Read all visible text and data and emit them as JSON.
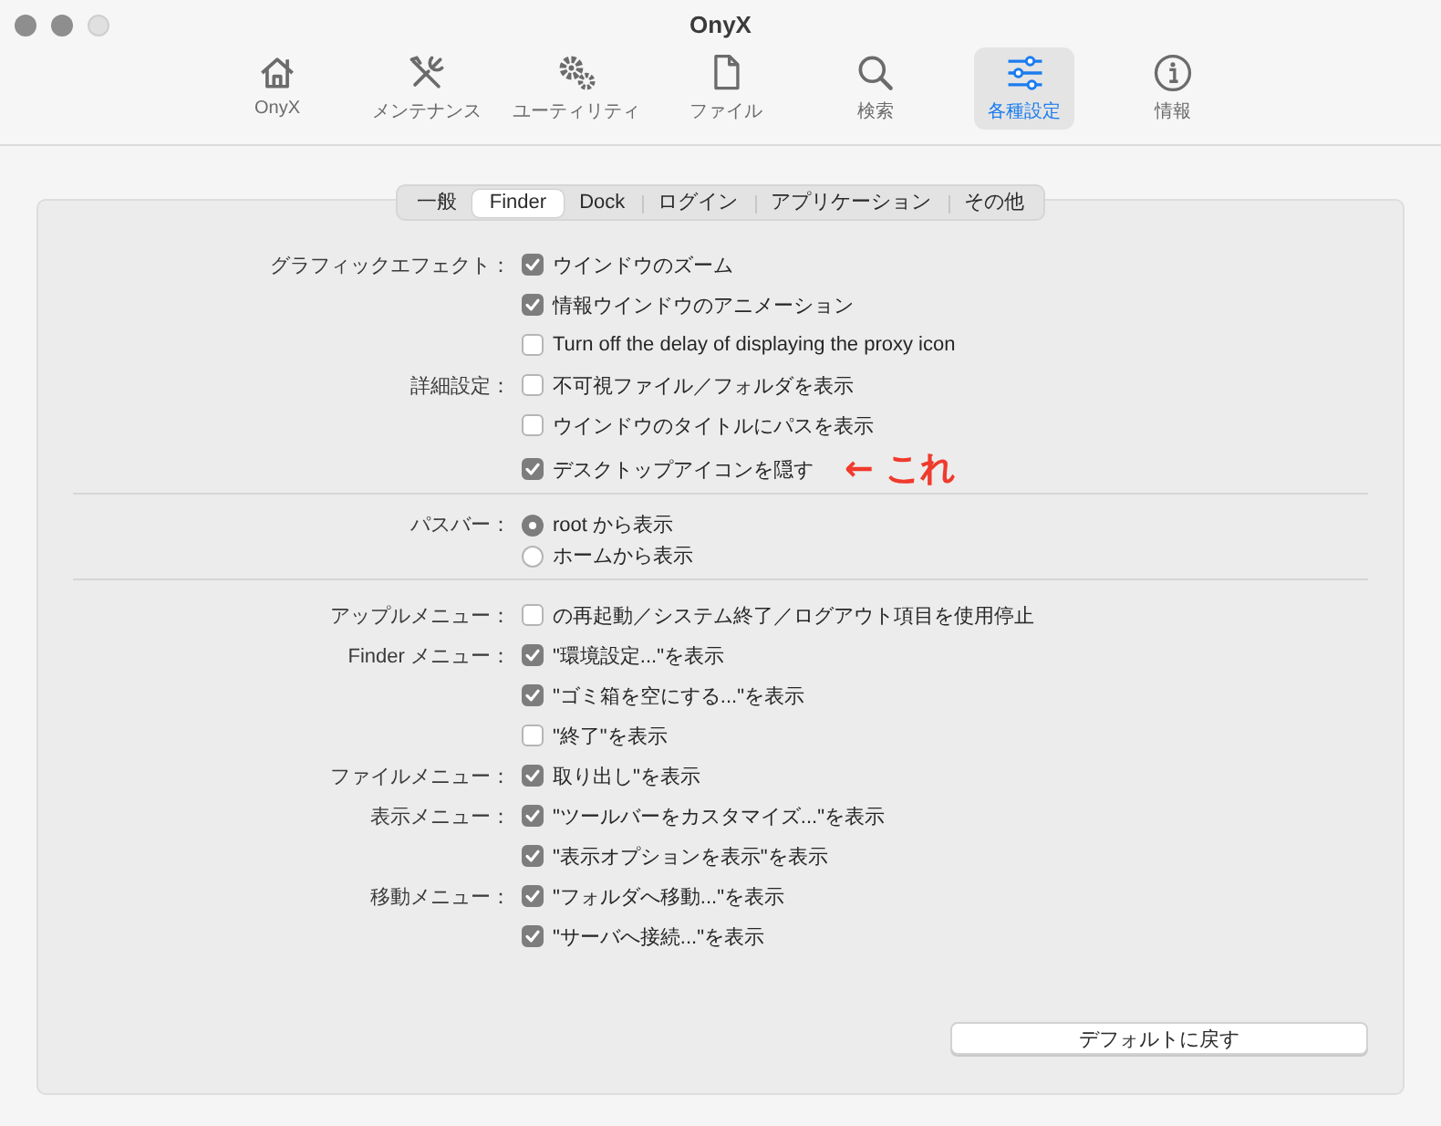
{
  "window": {
    "title": "OnyX"
  },
  "toolbar": [
    {
      "label": "OnyX",
      "kind": "home",
      "selected": false
    },
    {
      "label": "メンテナンス",
      "kind": "tools",
      "selected": false
    },
    {
      "label": "ユーティリティ",
      "kind": "gears",
      "selected": false
    },
    {
      "label": "ファイル",
      "kind": "file",
      "selected": false
    },
    {
      "label": "検索",
      "kind": "search",
      "selected": false
    },
    {
      "label": "各種設定",
      "kind": "sliders",
      "selected": true
    },
    {
      "label": "情報",
      "kind": "info",
      "selected": false
    }
  ],
  "tabs": [
    {
      "label": "一般",
      "selected": false
    },
    {
      "label": "Finder",
      "selected": true
    },
    {
      "label": "Dock",
      "selected": false
    },
    {
      "label": "ログイン",
      "selected": false
    },
    {
      "label": "アプリケーション",
      "selected": false
    },
    {
      "label": "その他",
      "selected": false
    }
  ],
  "sections": [
    [
      {
        "label": "グラフィックエフェクト：",
        "kind": "checkbox",
        "text": "ウインドウのズーム",
        "checked": true
      },
      {
        "kind": "checkbox",
        "text": "情報ウインドウのアニメーション",
        "checked": true
      },
      {
        "kind": "checkbox",
        "text": "Turn off the delay of displaying the proxy icon",
        "checked": false
      },
      {
        "label": "詳細設定：",
        "kind": "checkbox",
        "text": "不可視ファイル／フォルダを表示",
        "checked": false
      },
      {
        "kind": "checkbox",
        "text": "ウインドウのタイトルにパスを表示",
        "checked": false
      },
      {
        "kind": "checkbox",
        "text": "デスクトップアイコンを隠す",
        "checked": true,
        "annotation": "← これ"
      }
    ],
    [
      {
        "label": "パスバー：",
        "kind": "radio",
        "text": "root から表示",
        "selected": true
      },
      {
        "kind": "radio",
        "text": "ホームから表示",
        "selected": false
      }
    ],
    [
      {
        "label": "アップルメニュー：",
        "kind": "checkbox",
        "text": "の再起動／システム終了／ログアウト項目を使用停止",
        "checked": false
      },
      {
        "label": "Finder メニュー：",
        "kind": "checkbox",
        "text": "\"環境設定...\"を表示",
        "checked": true
      },
      {
        "kind": "checkbox",
        "text": "\"ゴミ箱を空にする...\"を表示",
        "checked": true
      },
      {
        "kind": "checkbox",
        "text": "\"終了\"を表示",
        "checked": false
      },
      {
        "label": "ファイルメニュー：",
        "kind": "checkbox",
        "text": "取り出し\"を表示",
        "checked": true
      },
      {
        "label": "表示メニュー：",
        "kind": "checkbox",
        "text": "\"ツールバーをカスタマイズ...\"を表示",
        "checked": true
      },
      {
        "kind": "checkbox",
        "text": "\"表示オプションを表示\"を表示",
        "checked": true
      },
      {
        "label": "移動メニュー：",
        "kind": "checkbox",
        "text": "\"フォルダへ移動...\"を表示",
        "checked": true
      },
      {
        "kind": "checkbox",
        "text": "\"サーバへ接続...\"を表示",
        "checked": true
      }
    ]
  ],
  "button": "デフォルトに戻す"
}
